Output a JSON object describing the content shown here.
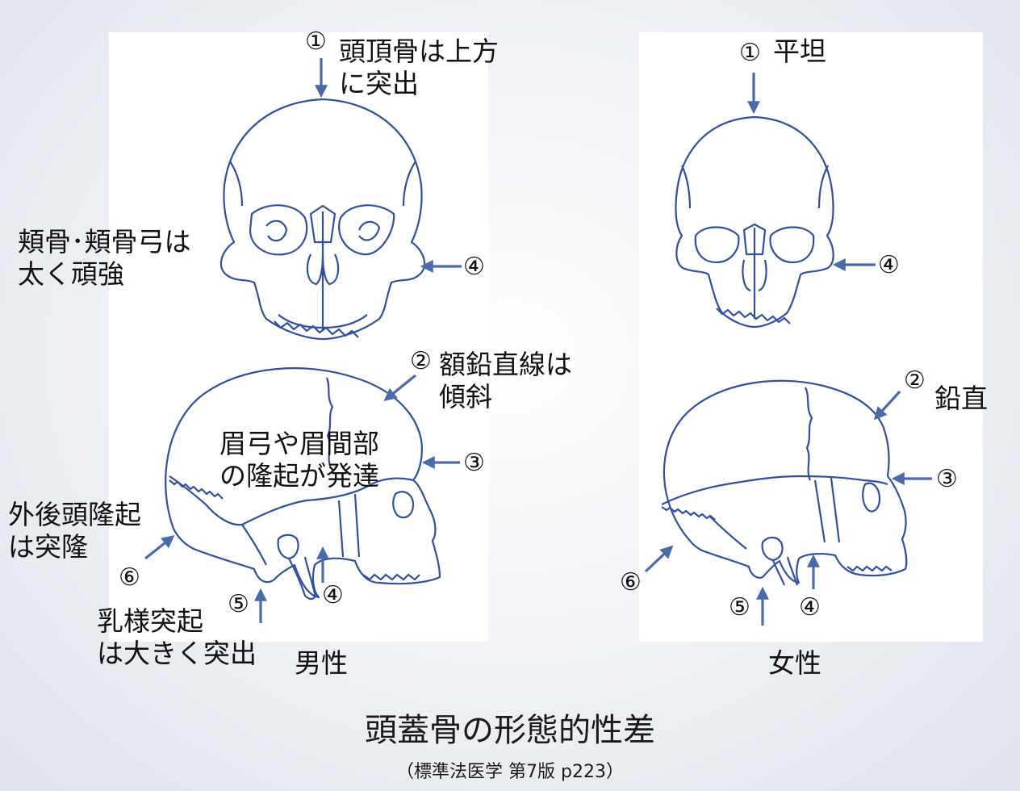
{
  "male": {
    "caption": "男性",
    "labels": {
      "crown": "頭頂骨は上方\nに突出",
      "zygoma": "頬骨･頬骨弓は\n太く頑強",
      "forehead": "額鉛直線は\n傾斜",
      "brow": "眉弓や眉間部\nの隆起が発達",
      "occipital": "外後頭隆起\nは突隆",
      "mastoid": "乳様突起\nは大きく突出"
    },
    "markers": {
      "m1": "①",
      "m2": "②",
      "m3": "③",
      "m4a": "④",
      "m4b": "④",
      "m5": "⑤",
      "m6": "⑥"
    }
  },
  "female": {
    "caption": "女性",
    "labels": {
      "crown": "平坦",
      "forehead": "鉛直"
    },
    "markers": {
      "m1": "①",
      "m2": "②",
      "m3": "③",
      "m4a": "④",
      "m4b": "④",
      "m5": "⑤",
      "m6": "⑥"
    }
  },
  "title": "頭蓋骨の形態的性差",
  "source": "（標準法医学 第7版 p223）",
  "colors": {
    "line": "#2f4fa0",
    "arrow": "#4a6aaa"
  }
}
